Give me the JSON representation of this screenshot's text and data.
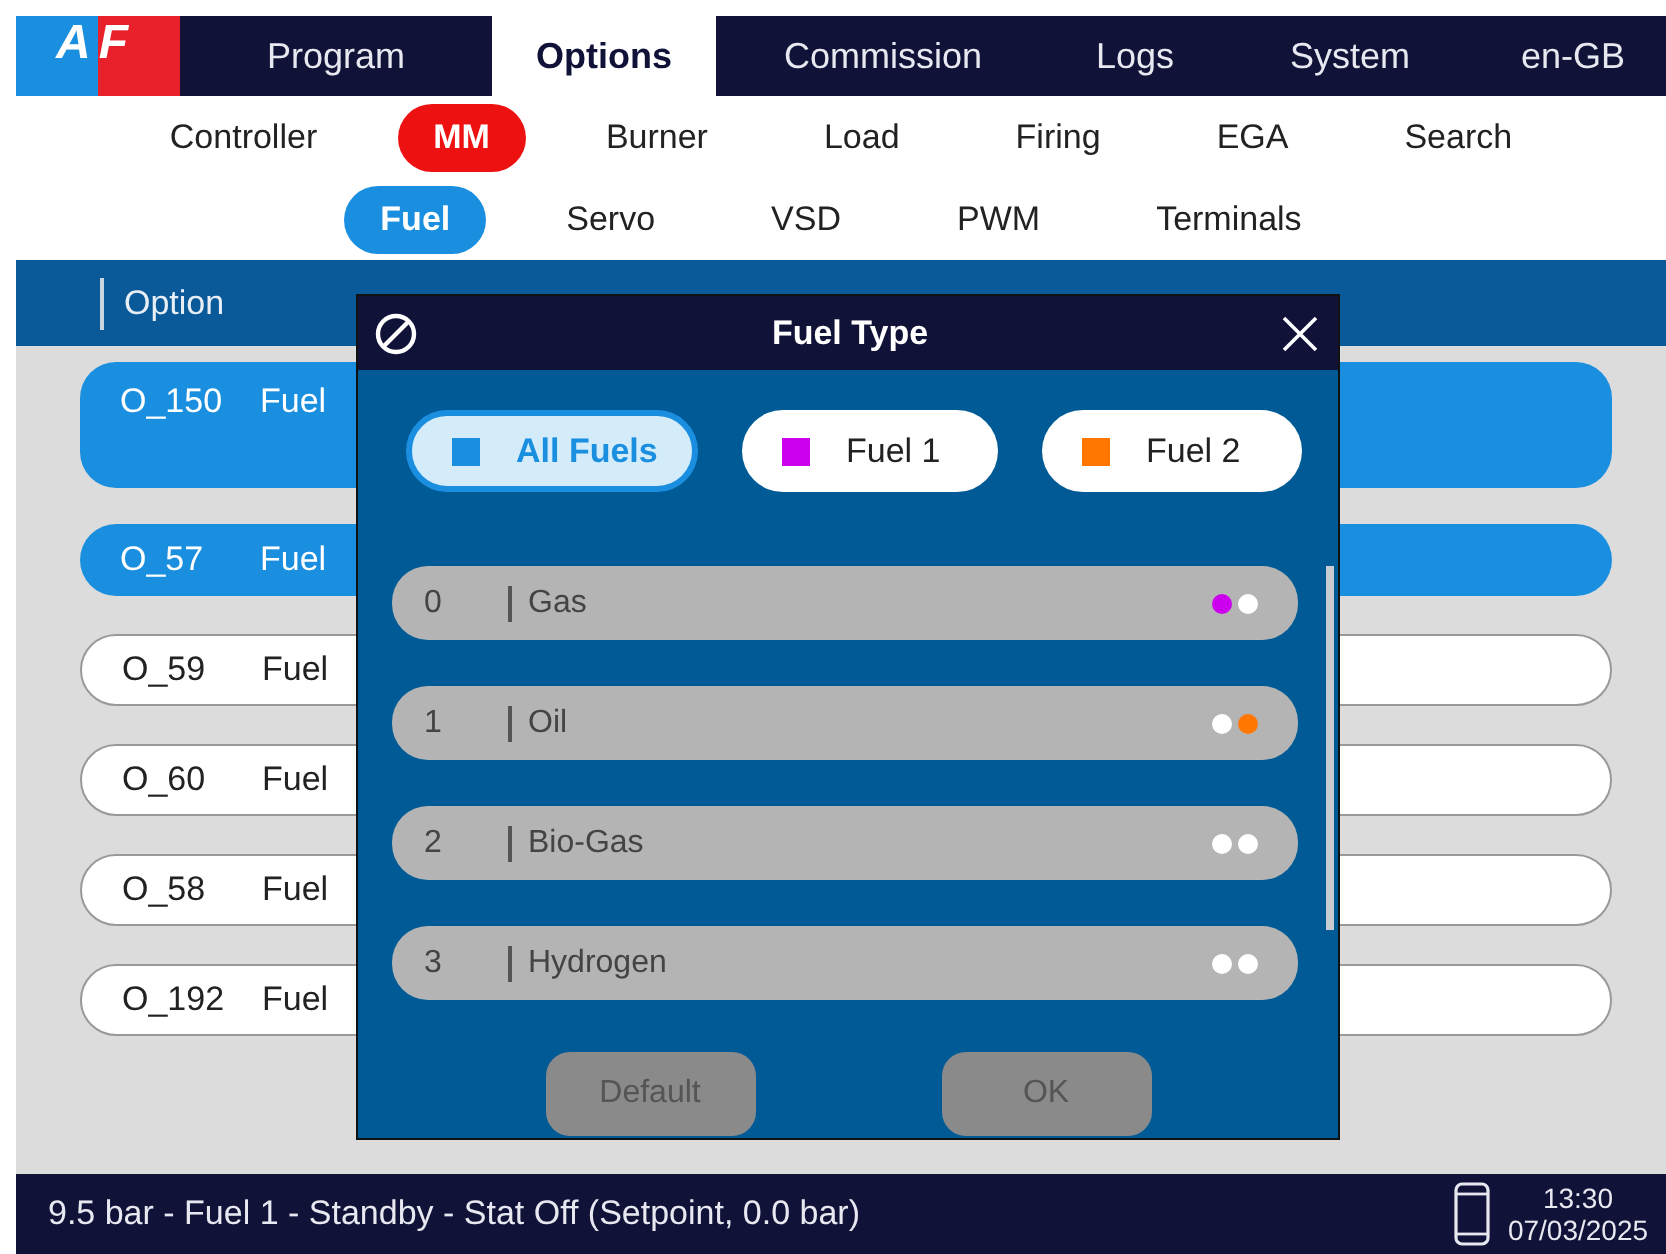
{
  "top_nav": [
    {
      "label": "Program",
      "selected": false
    },
    {
      "label": "Options",
      "selected": true
    },
    {
      "label": "Commission",
      "selected": false
    },
    {
      "label": "Logs",
      "selected": false
    },
    {
      "label": "System",
      "selected": false
    },
    {
      "label": "en-GB",
      "selected": false
    }
  ],
  "logo": "AF",
  "sub_nav": [
    {
      "label": "Controller",
      "selected": false
    },
    {
      "label": "MM",
      "selected": true
    },
    {
      "label": "Burner",
      "selected": false
    },
    {
      "label": "Load",
      "selected": false
    },
    {
      "label": "Firing",
      "selected": false
    },
    {
      "label": "EGA",
      "selected": false
    },
    {
      "label": "Search",
      "selected": false
    }
  ],
  "section_nav": [
    {
      "label": "Fuel",
      "selected": true
    },
    {
      "label": "Servo",
      "selected": false
    },
    {
      "label": "VSD",
      "selected": false
    },
    {
      "label": "PWM",
      "selected": false
    },
    {
      "label": "Terminals",
      "selected": false
    }
  ],
  "table": {
    "columns": [
      "Option"
    ],
    "rows": [
      {
        "id": "O_150",
        "name": "Fuel",
        "selected": true,
        "tall": true
      },
      {
        "id": "O_57",
        "name": "Fuel",
        "selected": true,
        "tall": false
      },
      {
        "id": "O_59",
        "name": "Fuel",
        "selected": false,
        "tall": false
      },
      {
        "id": "O_60",
        "name": "Fuel",
        "selected": false,
        "tall": false
      },
      {
        "id": "O_58",
        "name": "Fuel",
        "selected": false,
        "tall": false
      },
      {
        "id": "O_192",
        "name": "Fuel",
        "selected": false,
        "tall": false
      }
    ]
  },
  "dialog": {
    "title": "Fuel Type",
    "filters": [
      {
        "label": "All Fuels",
        "selected": true,
        "color": "#1a8fe0"
      },
      {
        "label": "Fuel 1",
        "selected": false,
        "color": "#cc00ee"
      },
      {
        "label": "Fuel 2",
        "selected": false,
        "color": "#ff7700"
      }
    ],
    "items": [
      {
        "number": "0",
        "name": "Gas",
        "fuel_1": true,
        "fuel_2": false
      },
      {
        "number": "1",
        "name": "Oil",
        "fuel_1": false,
        "fuel_2": true
      },
      {
        "number": "2",
        "name": "Bio-Gas",
        "fuel_1": false,
        "fuel_2": false
      },
      {
        "number": "3",
        "name": "Hydrogen",
        "fuel_1": false,
        "fuel_2": false
      }
    ],
    "buttons": [
      {
        "label": "Default",
        "disabled": true
      },
      {
        "label": "OK",
        "disabled": true
      }
    ]
  },
  "status_bar": {
    "text": "9.5 bar - Fuel 1 - Standby - Stat Off (Setpoint, 0.0 bar)",
    "time": "13:30",
    "date": "07/03/2025"
  }
}
